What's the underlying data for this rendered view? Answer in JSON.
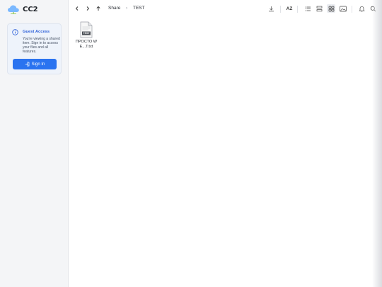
{
  "app": {
    "name": "CC2"
  },
  "guest": {
    "title": "Guest Access",
    "message": "You're viewing a shared item. Sign in to access your files and all features.",
    "signin_label": "Sign In"
  },
  "breadcrumb": {
    "items": [
      "Share",
      "TEST"
    ]
  },
  "toolbar": {
    "icons": [
      "back-icon",
      "forward-icon",
      "up-icon",
      "download-icon",
      "sort-az-icon",
      "list-view-icon",
      "compact-list-icon",
      "grid-view-icon",
      "gallery-view-icon",
      "bell-icon",
      "search-icon"
    ],
    "sort_label": "AZ",
    "active_view": "grid"
  },
  "files": [
    {
      "name": "ПРОСТО W E...T.txt",
      "icon_label": "TEST",
      "type": "txt"
    }
  ],
  "colors": {
    "accent": "#2a73f0",
    "sidebar_bg": "#f4f5f7",
    "card_bg": "#eef3fb"
  }
}
